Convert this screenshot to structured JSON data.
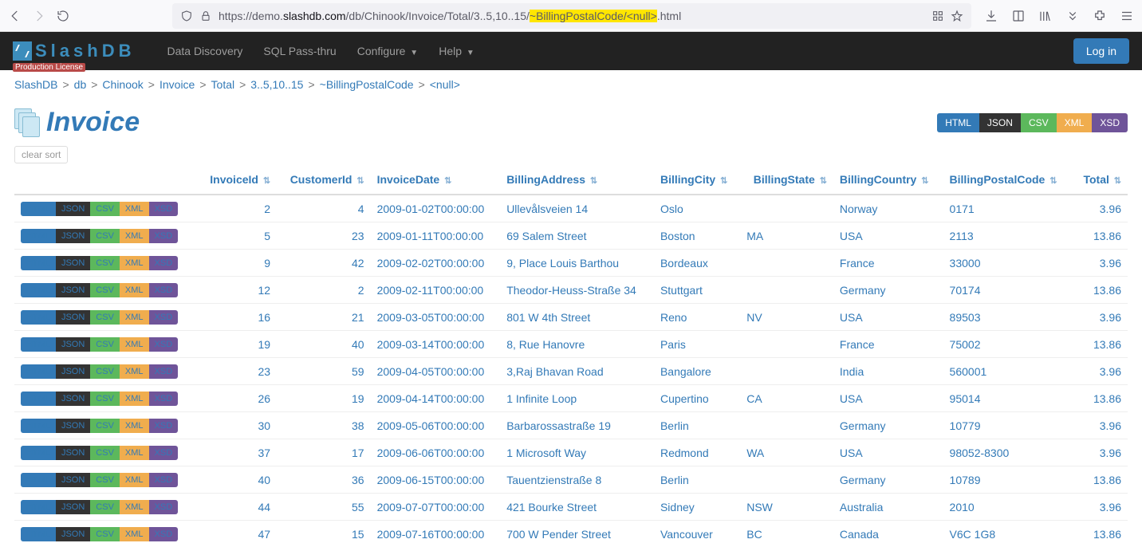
{
  "url": {
    "pre": "https://demo.",
    "domain": "slashdb.com",
    "path1": "/db/Chinook/Invoice/Total/3..5,10..15/",
    "hl1": "~BillingPostalCode/",
    "hl2": "<null>",
    "suffix": ".html"
  },
  "app": {
    "logo_text": "SlashDB",
    "license": "Production License",
    "login": "Log in"
  },
  "nav": {
    "discovery": "Data Discovery",
    "sql": "SQL Pass-thru",
    "configure": "Configure",
    "help": "Help"
  },
  "breadcrumbs": [
    "SlashDB",
    "db",
    "Chinook",
    "Invoice",
    "Total",
    "3..5,10..15",
    "~BillingPostalCode",
    "<null>"
  ],
  "page_title": "Invoice",
  "clear_sort": "clear sort",
  "formats": {
    "html": "HTML",
    "json": "JSON",
    "csv": "CSV",
    "xml": "XML",
    "xsd": "XSD"
  },
  "columns": {
    "invoiceId": "InvoiceId",
    "customerId": "CustomerId",
    "invoiceDate": "InvoiceDate",
    "billingAddress": "BillingAddress",
    "billingCity": "BillingCity",
    "billingState": "BillingState",
    "billingCountry": "BillingCountry",
    "billingPostalCode": "BillingPostalCode",
    "total": "Total"
  },
  "null_label": "<null>",
  "rows": [
    {
      "invoiceId": "2",
      "customerId": "4",
      "invoiceDate": "2009-01-02T00:00:00",
      "billingAddress": "Ullevålsveien 14",
      "billingCity": "Oslo",
      "billingState": null,
      "billingCountry": "Norway",
      "billingPostalCode": "0171",
      "total": "3.96"
    },
    {
      "invoiceId": "5",
      "customerId": "23",
      "invoiceDate": "2009-01-11T00:00:00",
      "billingAddress": "69 Salem Street",
      "billingCity": "Boston",
      "billingState": "MA",
      "billingCountry": "USA",
      "billingPostalCode": "2113",
      "total": "13.86"
    },
    {
      "invoiceId": "9",
      "customerId": "42",
      "invoiceDate": "2009-02-02T00:00:00",
      "billingAddress": "9, Place Louis Barthou",
      "billingCity": "Bordeaux",
      "billingState": null,
      "billingCountry": "France",
      "billingPostalCode": "33000",
      "total": "3.96"
    },
    {
      "invoiceId": "12",
      "customerId": "2",
      "invoiceDate": "2009-02-11T00:00:00",
      "billingAddress": "Theodor-Heuss-Straße 34",
      "billingCity": "Stuttgart",
      "billingState": null,
      "billingCountry": "Germany",
      "billingPostalCode": "70174",
      "total": "13.86"
    },
    {
      "invoiceId": "16",
      "customerId": "21",
      "invoiceDate": "2009-03-05T00:00:00",
      "billingAddress": "801 W 4th Street",
      "billingCity": "Reno",
      "billingState": "NV",
      "billingCountry": "USA",
      "billingPostalCode": "89503",
      "total": "3.96"
    },
    {
      "invoiceId": "19",
      "customerId": "40",
      "invoiceDate": "2009-03-14T00:00:00",
      "billingAddress": "8, Rue Hanovre",
      "billingCity": "Paris",
      "billingState": null,
      "billingCountry": "France",
      "billingPostalCode": "75002",
      "total": "13.86"
    },
    {
      "invoiceId": "23",
      "customerId": "59",
      "invoiceDate": "2009-04-05T00:00:00",
      "billingAddress": "3,Raj Bhavan Road",
      "billingCity": "Bangalore",
      "billingState": null,
      "billingCountry": "India",
      "billingPostalCode": "560001",
      "total": "3.96"
    },
    {
      "invoiceId": "26",
      "customerId": "19",
      "invoiceDate": "2009-04-14T00:00:00",
      "billingAddress": "1 Infinite Loop",
      "billingCity": "Cupertino",
      "billingState": "CA",
      "billingCountry": "USA",
      "billingPostalCode": "95014",
      "total": "13.86"
    },
    {
      "invoiceId": "30",
      "customerId": "38",
      "invoiceDate": "2009-05-06T00:00:00",
      "billingAddress": "Barbarossastraße 19",
      "billingCity": "Berlin",
      "billingState": null,
      "billingCountry": "Germany",
      "billingPostalCode": "10779",
      "total": "3.96"
    },
    {
      "invoiceId": "37",
      "customerId": "17",
      "invoiceDate": "2009-06-06T00:00:00",
      "billingAddress": "1 Microsoft Way",
      "billingCity": "Redmond",
      "billingState": "WA",
      "billingCountry": "USA",
      "billingPostalCode": "98052-8300",
      "total": "3.96"
    },
    {
      "invoiceId": "40",
      "customerId": "36",
      "invoiceDate": "2009-06-15T00:00:00",
      "billingAddress": "Tauentzienstraße 8",
      "billingCity": "Berlin",
      "billingState": null,
      "billingCountry": "Germany",
      "billingPostalCode": "10789",
      "total": "13.86"
    },
    {
      "invoiceId": "44",
      "customerId": "55",
      "invoiceDate": "2009-07-07T00:00:00",
      "billingAddress": "421 Bourke Street",
      "billingCity": "Sidney",
      "billingState": "NSW",
      "billingCountry": "Australia",
      "billingPostalCode": "2010",
      "total": "3.96"
    },
    {
      "invoiceId": "47",
      "customerId": "15",
      "invoiceDate": "2009-07-16T00:00:00",
      "billingAddress": "700 W Pender Street",
      "billingCity": "Vancouver",
      "billingState": "BC",
      "billingCountry": "Canada",
      "billingPostalCode": "V6C 1G8",
      "total": "13.86"
    }
  ]
}
